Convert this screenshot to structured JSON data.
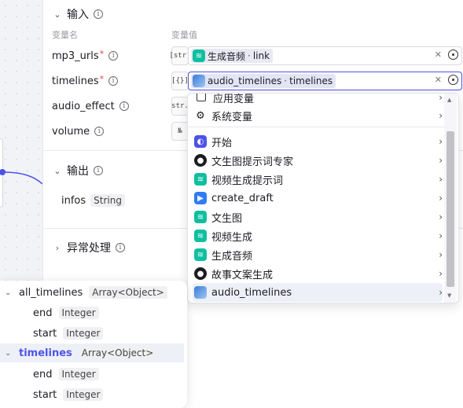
{
  "input_section": {
    "title": "输入",
    "col_name": "变量名",
    "col_value": "变量值",
    "rows": [
      {
        "name": "mp3_urls",
        "required": "*",
        "type": "[str]",
        "ref_node": "生成音频",
        "ref_field": "link"
      },
      {
        "name": "timelines",
        "required": "*",
        "type": "[{}]",
        "ref_node": "audio_timelines",
        "ref_field": "timelines"
      },
      {
        "name": "audio_effect",
        "type": "str."
      },
      {
        "name": "volume",
        "type": "№"
      }
    ]
  },
  "output_section": {
    "title": "输出",
    "outputs": [
      {
        "name": "infos",
        "type": "String"
      }
    ]
  },
  "error_section": {
    "title": "异常处理"
  },
  "dropdown": {
    "items": [
      {
        "label": "应用变量",
        "icon": "box-icon"
      },
      {
        "label": "系统变量",
        "icon": "gear-icon"
      },
      {
        "label": "开始",
        "icon": "start-icon"
      },
      {
        "label": "文生图提示词专家",
        "icon": "agent-icon"
      },
      {
        "label": "视频生成提示词",
        "icon": "layers-icon"
      },
      {
        "label": "create_draft",
        "icon": "video-icon"
      },
      {
        "label": "文生图",
        "icon": "layers-icon"
      },
      {
        "label": "视频生成",
        "icon": "layers-icon"
      },
      {
        "label": "生成音频",
        "icon": "layers-icon"
      },
      {
        "label": "故事文案生成",
        "icon": "agent-icon"
      },
      {
        "label": "audio_timelines",
        "icon": "photo-icon"
      }
    ]
  },
  "tree": {
    "rows": [
      {
        "name": "all_timelines",
        "type": "Array<Object>"
      },
      {
        "name": "end",
        "type": "Integer"
      },
      {
        "name": "start",
        "type": "Integer"
      },
      {
        "name": "timelines",
        "type": "Array<Object>"
      },
      {
        "name": "end",
        "type": "Integer"
      },
      {
        "name": "start",
        "type": "Integer"
      }
    ]
  },
  "colors": {
    "accent": "#4d53e8",
    "teal": "#0fbf9f",
    "required": "#e64545"
  }
}
